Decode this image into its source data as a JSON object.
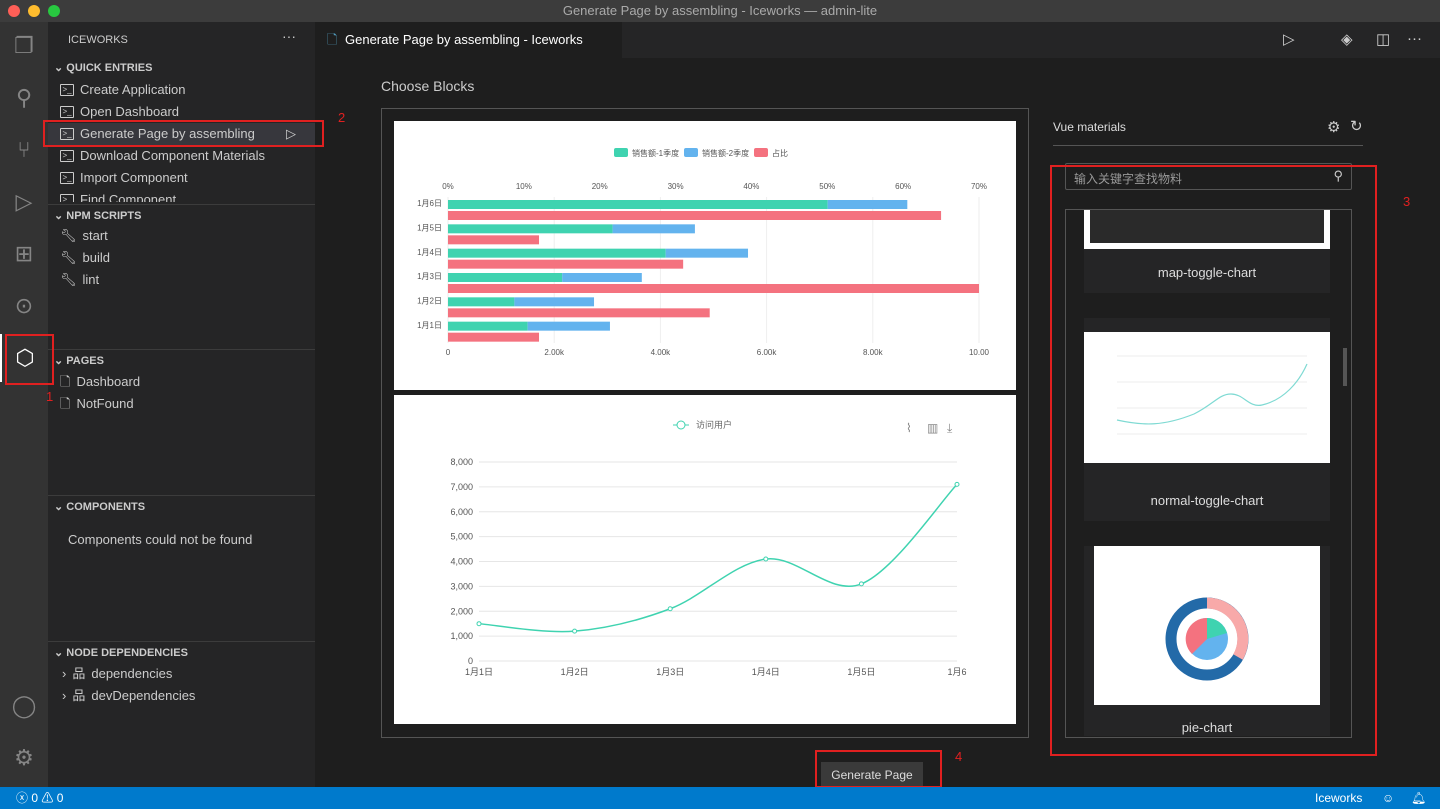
{
  "window": {
    "title": "Generate Page by assembling - Iceworks — admin-lite"
  },
  "activity_bar": {
    "items": [
      "explorer-icon",
      "search-icon",
      "source-control-icon",
      "run-debug-icon",
      "extensions-icon",
      "git-graph-icon",
      "iceworks-icon"
    ],
    "bottom": [
      "account-icon",
      "settings-gear-icon"
    ]
  },
  "sidebar": {
    "title": "ICEWORKS",
    "quick_entries": {
      "header": "QUICK ENTRIES",
      "items": [
        "Create Application",
        "Open Dashboard",
        "Generate Page by assembling",
        "Download Component Materials",
        "Import Component",
        "Find Component"
      ]
    },
    "npm_scripts": {
      "header": "NPM SCRIPTS",
      "items": [
        "start",
        "build",
        "lint"
      ]
    },
    "pages": {
      "header": "PAGES",
      "items": [
        "Dashboard",
        "NotFound"
      ]
    },
    "components": {
      "header": "COMPONENTS",
      "empty": "Components could not be found"
    },
    "node_deps": {
      "header": "NODE DEPENDENCIES",
      "items": [
        "dependencies",
        "devDependencies"
      ]
    }
  },
  "tab": {
    "label": "Generate Page by assembling - Iceworks"
  },
  "editor": {
    "heading": "Choose Blocks",
    "generate_button": "Generate Page",
    "materials": {
      "tab": "Vue materials",
      "search_placeholder": "输入关键字查找物料",
      "items": [
        "map-toggle-chart",
        "normal-toggle-chart",
        "pie-chart"
      ]
    }
  },
  "annotations": [
    "1",
    "2",
    "3",
    "4"
  ],
  "status": {
    "errors": "0",
    "warnings": "0",
    "right": "Iceworks"
  },
  "colors": {
    "accent": "#007acc",
    "annotation": "#e02020",
    "green": "#3fd3b0",
    "blue": "#63b3ee",
    "red": "#f4727f"
  },
  "chart_data": [
    {
      "type": "bar",
      "orientation": "horizontal",
      "categories": [
        "1月1日",
        "1月2日",
        "1月3日",
        "1月4日",
        "1月5日",
        "1月6日"
      ],
      "series": [
        {
          "name": "销售额-1季度",
          "values": [
            1500,
            1250,
            2150,
            4100,
            3100,
            7150
          ],
          "stack": "a",
          "axis": "bottom"
        },
        {
          "name": "销售额-2季度",
          "values": [
            1550,
            1500,
            1500,
            1550,
            1550,
            1500
          ],
          "stack": "a",
          "axis": "bottom"
        },
        {
          "name": "占比",
          "values": [
            12,
            34.5,
            70,
            31,
            12,
            65
          ],
          "axis": "top"
        }
      ],
      "x_bottom": {
        "ticks": [
          "0",
          "2.00k",
          "4.00k",
          "6.00k",
          "8.00k",
          "10.00"
        ],
        "range": [
          0,
          10000
        ]
      },
      "x_top": {
        "ticks": [
          "0%",
          "10%",
          "20%",
          "30%",
          "40%",
          "50%",
          "60%",
          "70%"
        ],
        "range": [
          0,
          70
        ]
      },
      "legend": "top"
    },
    {
      "type": "line",
      "smooth": true,
      "series": [
        {
          "name": "访问用户",
          "values": [
            1500,
            1200,
            2100,
            4100,
            3100,
            7100
          ]
        }
      ],
      "categories": [
        "1月1日",
        "1月2日",
        "1月3日",
        "1月4日",
        "1月5日",
        "1月6"
      ],
      "y_ticks": [
        "0",
        "1,000",
        "2,000",
        "3,000",
        "4,000",
        "5,000",
        "6,000",
        "7,000",
        "8,000"
      ],
      "ylim": [
        0,
        8000
      ],
      "legend": "top",
      "grid": true
    }
  ]
}
